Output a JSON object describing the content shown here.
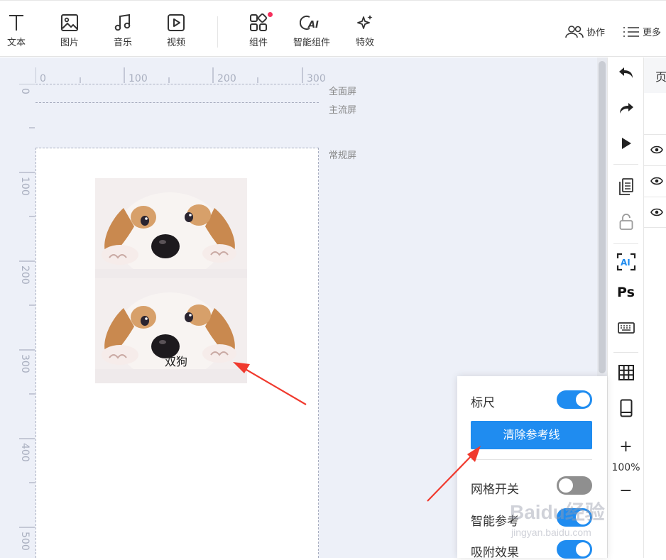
{
  "toolbar": {
    "items": [
      {
        "label": "文本",
        "icon": "text-icon"
      },
      {
        "label": "图片",
        "icon": "image-icon"
      },
      {
        "label": "音乐",
        "icon": "music-icon"
      },
      {
        "label": "视频",
        "icon": "video-icon"
      },
      {
        "label": "组件",
        "icon": "component-icon"
      },
      {
        "label": "智能组件",
        "icon": "ai-component-icon"
      },
      {
        "label": "特效",
        "icon": "effects-icon"
      }
    ],
    "collab_label": "协作",
    "more_label": "更多"
  },
  "ruler": {
    "h_ticks": [
      "0",
      "100",
      "200",
      "300"
    ],
    "v_ticks": [
      "0",
      "100",
      "200",
      "300",
      "400",
      "500"
    ]
  },
  "zones": {
    "full": "全面屏",
    "main": "主流屏",
    "normal": "常规屏"
  },
  "canvas": {
    "caption": "双狗"
  },
  "right_toolbar": {
    "zoom": "100%",
    "ps_label": "Ps",
    "ai_label": "AI",
    "zoom_in": "+",
    "zoom_out": "−"
  },
  "layer_panel": {
    "header": "页"
  },
  "popup": {
    "ruler_label": "标尺",
    "ruler_on": true,
    "clear_button": "清除参考线",
    "grid_label": "网格开关",
    "grid_on": false,
    "smart_label": "智能参考",
    "smart_on": true,
    "snap_label": "吸附效果",
    "snap_on": true
  },
  "watermark": {
    "brand": "Baidu经验",
    "url": "jingyan.baidu.com"
  },
  "colors": {
    "accent": "#1f8cf0",
    "workarea": "#edf0f8",
    "arrow": "#f03a2e"
  }
}
